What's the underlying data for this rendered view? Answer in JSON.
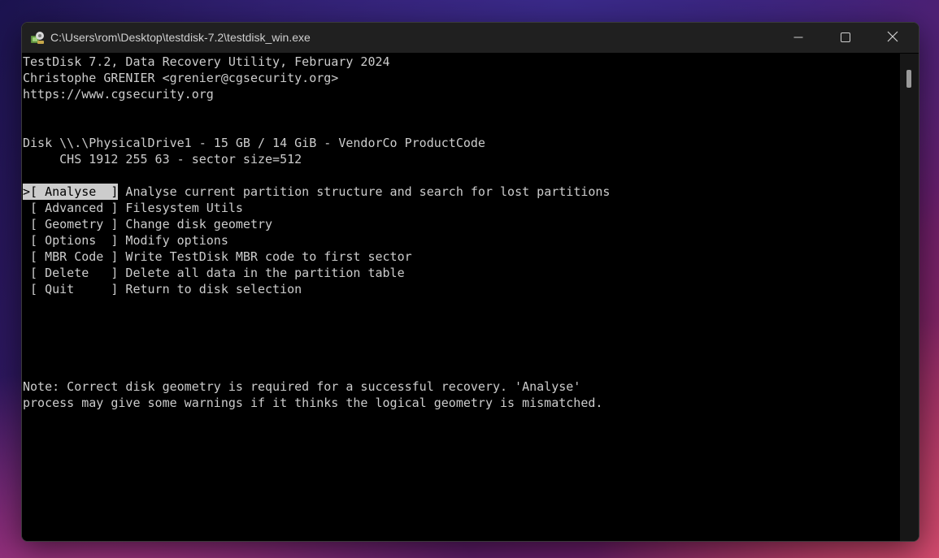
{
  "window": {
    "title": "C:\\Users\\rom\\Desktop\\testdisk-7.2\\testdisk_win.exe",
    "icon": "testdisk-app-icon",
    "controls": {
      "minimize_icon": "minimize-icon",
      "maximize_icon": "maximize-icon",
      "close_icon": "close-icon"
    }
  },
  "terminal": {
    "header": {
      "line1": "TestDisk 7.2, Data Recovery Utility, February 2024",
      "line2": "Christophe GRENIER <grenier@cgsecurity.org>",
      "line3": "https://www.cgsecurity.org"
    },
    "disk": {
      "line1": "Disk \\\\.\\PhysicalDrive1 - 15 GB / 14 GiB - VendorCo ProductCode",
      "line2": "     CHS 1912 255 63 - sector size=512"
    },
    "menu": [
      {
        "prefix": ">",
        "label": "[ Analyse  ]",
        "description": " Analyse current partition structure and search for lost partitions",
        "selected": true
      },
      {
        "prefix": " ",
        "label": "[ Advanced ]",
        "description": " Filesystem Utils",
        "selected": false
      },
      {
        "prefix": " ",
        "label": "[ Geometry ]",
        "description": " Change disk geometry",
        "selected": false
      },
      {
        "prefix": " ",
        "label": "[ Options  ]",
        "description": " Modify options",
        "selected": false
      },
      {
        "prefix": " ",
        "label": "[ MBR Code ]",
        "description": " Write TestDisk MBR code to first sector",
        "selected": false
      },
      {
        "prefix": " ",
        "label": "[ Delete   ]",
        "description": " Delete all data in the partition table",
        "selected": false
      },
      {
        "prefix": " ",
        "label": "[ Quit     ]",
        "description": " Return to disk selection",
        "selected": false
      }
    ],
    "note": {
      "line1": "Note: Correct disk geometry is required for a successful recovery. 'Analyse'",
      "line2": "process may give some warnings if it thinks the logical geometry is mismatched."
    }
  },
  "colors": {
    "terminal_bg": "#000000",
    "terminal_fg": "#cccccc",
    "selection_bg": "#cccccc",
    "titlebar_bg": "#202020"
  }
}
